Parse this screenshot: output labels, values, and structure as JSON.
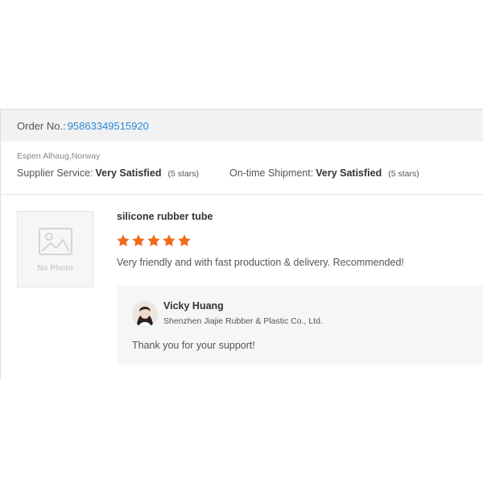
{
  "order": {
    "label": "Order No.:",
    "number": "95863349515920"
  },
  "buyer": {
    "name_location": "Espen Alhaug,Norway"
  },
  "ratings": [
    {
      "label": "Supplier Service:",
      "value": "Very Satisfied",
      "stars_text": "(5 stars)"
    },
    {
      "label": "On-time Shipment:",
      "value": "Very Satisfied",
      "stars_text": "(5 stars)"
    }
  ],
  "review": {
    "thumbnail_text": "No Photo",
    "product_name": "silicone rubber tube",
    "rating": 5,
    "max_rating": 5,
    "comment": "Very friendly and with fast production & delivery. Recommended!",
    "star_color": "#f06a1a",
    "reply": {
      "name": "Vicky Huang",
      "company": "Shenzhen Jiajie Rubber & Plastic Co., Ltd.",
      "text": "Thank you for your support!"
    }
  },
  "colors": {
    "link": "#2a88d8",
    "header_bg": "#f2f2f2",
    "reply_bg": "#f5f6f7"
  }
}
